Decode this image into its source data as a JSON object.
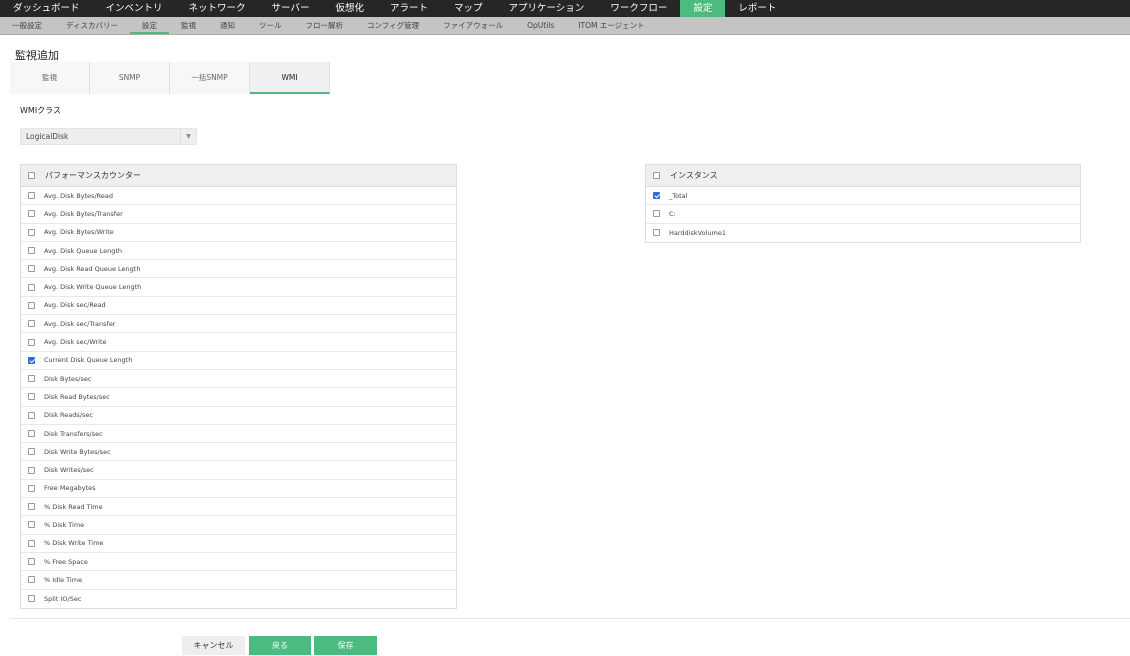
{
  "topnav": [
    "ダッシュボード",
    "インベントリ",
    "ネットワーク",
    "サーバー",
    "仮想化",
    "アラート",
    "マップ",
    "アプリケーション",
    "ワークフロー",
    "設定",
    "レポート"
  ],
  "topnav_active": 9,
  "subnav": [
    "一般設定",
    "ディスカバリー",
    "設定",
    "監視",
    "通知",
    "ツール",
    "フロー解析",
    "コンフィグ管理",
    "ファイアウォール",
    "OpUtils",
    "ITOM エージェント"
  ],
  "subnav_active": 2,
  "page_title": "監視追加",
  "tabs": [
    "監視",
    "SNMP",
    "一括SNMP",
    "WMI"
  ],
  "tabs_active": 3,
  "wmi_label": "WMIクラス",
  "wmi_class": "LogicalDisk",
  "counters": {
    "header": "パフォーマンスカウンター",
    "items": [
      {
        "label": "Avg. Disk Bytes/Read",
        "checked": false
      },
      {
        "label": "Avg. Disk Bytes/Transfer",
        "checked": false
      },
      {
        "label": "Avg. Disk Bytes/Write",
        "checked": false
      },
      {
        "label": "Avg. Disk Queue Length",
        "checked": false
      },
      {
        "label": "Avg. Disk Read Queue Length",
        "checked": false
      },
      {
        "label": "Avg. Disk Write Queue Length",
        "checked": false
      },
      {
        "label": "Avg. Disk sec/Read",
        "checked": false
      },
      {
        "label": "Avg. Disk sec/Transfer",
        "checked": false
      },
      {
        "label": "Avg. Disk sec/Write",
        "checked": false
      },
      {
        "label": "Current Disk Queue Length",
        "checked": true
      },
      {
        "label": "Disk Bytes/sec",
        "checked": false
      },
      {
        "label": "Disk Read Bytes/sec",
        "checked": false
      },
      {
        "label": "Disk Reads/sec",
        "checked": false
      },
      {
        "label": "Disk Transfers/sec",
        "checked": false
      },
      {
        "label": "Disk Write Bytes/sec",
        "checked": false
      },
      {
        "label": "Disk Writes/sec",
        "checked": false
      },
      {
        "label": "Free Megabytes",
        "checked": false
      },
      {
        "label": "% Disk Read Time",
        "checked": false
      },
      {
        "label": "% Disk Time",
        "checked": false
      },
      {
        "label": "% Disk Write Time",
        "checked": false
      },
      {
        "label": "% Free Space",
        "checked": false
      },
      {
        "label": "% Idle Time",
        "checked": false
      },
      {
        "label": "Split IO/Sec",
        "checked": false
      }
    ]
  },
  "instances": {
    "header": "インスタンス",
    "items": [
      {
        "label": "_Total",
        "checked": true
      },
      {
        "label": "C:",
        "checked": false
      },
      {
        "label": "HarddiskVolume1",
        "checked": false
      }
    ]
  },
  "buttons": {
    "cancel": "キャンセル",
    "back": "戻る",
    "save": "保存"
  }
}
